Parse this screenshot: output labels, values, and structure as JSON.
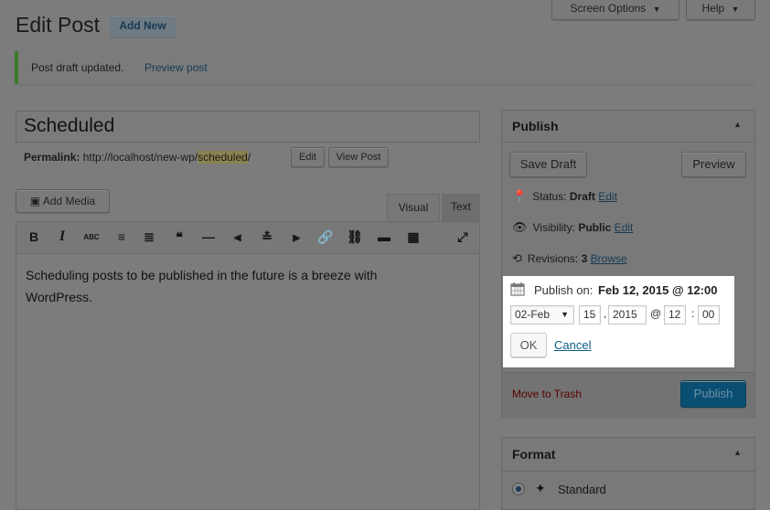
{
  "header": {
    "title": "Edit Post",
    "add_new": "Add New",
    "screen_options": "Screen Options",
    "help": "Help"
  },
  "notice": {
    "text": "Post draft updated.",
    "link": "Preview post"
  },
  "post": {
    "title": "Scheduled",
    "permalink_label": "Permalink:",
    "permalink_base": "http://localhost/new-wp/",
    "permalink_slug": "scheduled",
    "permalink_end": "/",
    "edit_button": "Edit",
    "view_post_button": "View Post"
  },
  "editor": {
    "add_media": "Add Media",
    "tab_visual": "Visual",
    "tab_text": "Text",
    "content": "Scheduling posts to be published in the future is a breeze with WordPress.",
    "toolbar": [
      {
        "name": "bold-icon",
        "glyph": "B"
      },
      {
        "name": "italic-icon",
        "glyph": "I"
      },
      {
        "name": "strikethrough-icon",
        "glyph": "ABC"
      },
      {
        "name": "bulleted-list-icon",
        "glyph": "≡"
      },
      {
        "name": "numbered-list-icon",
        "glyph": "≣"
      },
      {
        "name": "blockquote-icon",
        "glyph": "❝"
      },
      {
        "name": "horizontal-line-icon",
        "glyph": "—"
      },
      {
        "name": "align-left-icon",
        "glyph": "⫷"
      },
      {
        "name": "align-center-icon",
        "glyph": "≛"
      },
      {
        "name": "align-right-icon",
        "glyph": "⫸"
      },
      {
        "name": "insert-link-icon",
        "glyph": "🔗"
      },
      {
        "name": "remove-link-icon",
        "glyph": "⛓"
      },
      {
        "name": "read-more-icon",
        "glyph": "▬"
      },
      {
        "name": "toolbar-toggle-icon",
        "glyph": "▦"
      },
      {
        "name": "fullscreen-icon",
        "glyph": "⤢"
      }
    ]
  },
  "publish": {
    "title": "Publish",
    "save_draft": "Save Draft",
    "preview": "Preview",
    "status_label": "Status:",
    "status_value": "Draft",
    "visibility_label": "Visibility:",
    "visibility_value": "Public",
    "revisions_label": "Revisions:",
    "revisions_value": "3",
    "edit": "Edit",
    "browse": "Browse",
    "publish_on_label": "Publish on:",
    "publish_on_value": "Feb 12, 2015 @ 12:00",
    "month": "02-Feb",
    "day": "15",
    "year": "2015",
    "hour": "12",
    "minute": "00",
    "at": "@",
    "comma": ",",
    "colon": ":",
    "ok": "OK",
    "cancel": "Cancel",
    "move_to_trash": "Move to Trash",
    "publish_button": "Publish"
  },
  "format": {
    "title": "Format",
    "standard": "Standard"
  },
  "colors": {
    "overlay": "#7c7c7c",
    "accent": "#0a5c85",
    "trash": "#5a0000",
    "notice_bar": "#3a7a2a"
  }
}
